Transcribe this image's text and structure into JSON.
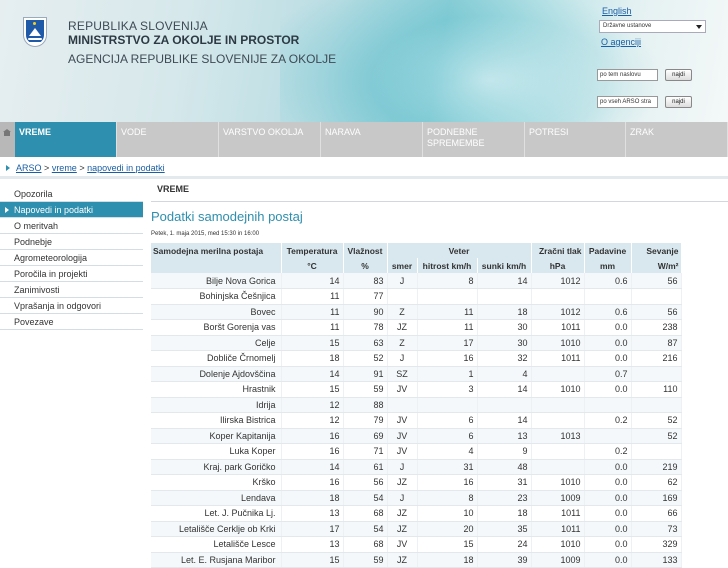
{
  "header": {
    "line1": "REPUBLIKA SLOVENIJA",
    "line2": "MINISTRSTVO ZA OKOLJE IN PROSTOR",
    "line3": "AGENCIJA REPUBLIKE SLOVENIJE ZA OKOLJE",
    "lang": "English",
    "select_value": "Državne ustanove",
    "o_agenciji": "O agenciji",
    "search1_value": "po tem naslovu",
    "search2_value": "po vseh ARSO stra",
    "search_button": "najdi"
  },
  "nav": [
    {
      "line1": "VREME",
      "line2": ""
    },
    {
      "line1": "VODE",
      "line2": ""
    },
    {
      "line1": "VARSTVO OKOLJA",
      "line2": ""
    },
    {
      "line1": "NARAVA",
      "line2": ""
    },
    {
      "line1": "PODNEBNE",
      "line2": "SPREMEMBE"
    },
    {
      "line1": "POTRESI",
      "line2": ""
    },
    {
      "line1": "ZRAK",
      "line2": ""
    }
  ],
  "breadcrumb": {
    "b1": "ARSO",
    "b2": "vreme",
    "b3": "napovedi in podatki",
    "sep": ">"
  },
  "sidebar": [
    "Opozorila",
    "Napovedi in podatki",
    "O meritvah",
    "Podnebje",
    "Agrometeorologija",
    "Poročila in projekti",
    "Zanimivosti",
    "Vprašanja in odgovori",
    "Povezave"
  ],
  "main": {
    "section": "VREME",
    "title": "Podatki samodejnih postaj",
    "date": "Petek, 1. maja 2015, med 15:30 in 16:00"
  },
  "table": {
    "h1": [
      "Samodejna merilna postaja",
      "Temperatura",
      "Vlažnost",
      "Veter",
      "Zračni tlak",
      "Padavine",
      "Sevanje"
    ],
    "h2": [
      "",
      "°C",
      "%",
      "smer",
      "hitrost km/h",
      "sunki km/h",
      "hPa",
      "mm",
      "W/m²"
    ],
    "rows": [
      [
        "Bilje Nova Gorica",
        "14",
        "83",
        "J",
        "8",
        "14",
        "1012",
        "0.6",
        "56"
      ],
      [
        "Bohinjska Češnjica",
        "11",
        "77",
        "",
        "",
        "",
        "",
        "",
        ""
      ],
      [
        "Bovec",
        "11",
        "90",
        "Z",
        "11",
        "18",
        "1012",
        "0.6",
        "56"
      ],
      [
        "Boršt Gorenja vas",
        "11",
        "78",
        "JZ",
        "11",
        "30",
        "1011",
        "0.0",
        "238"
      ],
      [
        "Celje",
        "15",
        "63",
        "Z",
        "17",
        "30",
        "1010",
        "0.0",
        "87"
      ],
      [
        "Dobliče Črnomelj",
        "18",
        "52",
        "J",
        "16",
        "32",
        "1011",
        "0.0",
        "216"
      ],
      [
        "Dolenje Ajdovščina",
        "14",
        "91",
        "SZ",
        "1",
        "4",
        "",
        "0.7",
        ""
      ],
      [
        "Hrastnik",
        "15",
        "59",
        "JV",
        "3",
        "14",
        "1010",
        "0.0",
        "110"
      ],
      [
        "Idrija",
        "12",
        "88",
        "",
        "",
        "",
        "",
        "",
        ""
      ],
      [
        "Ilirska Bistrica",
        "12",
        "79",
        "JV",
        "6",
        "14",
        "",
        "0.2",
        "52"
      ],
      [
        "Koper Kapitanija",
        "16",
        "69",
        "JV",
        "6",
        "13",
        "1013",
        "",
        "52"
      ],
      [
        "Luka Koper",
        "16",
        "71",
        "JV",
        "4",
        "9",
        "",
        "0.2",
        ""
      ],
      [
        "Kraj. park Goričko",
        "14",
        "61",
        "J",
        "31",
        "48",
        "",
        "0.0",
        "219"
      ],
      [
        "Krško",
        "16",
        "56",
        "JZ",
        "16",
        "31",
        "1010",
        "0.0",
        "62"
      ],
      [
        "Lendava",
        "18",
        "54",
        "J",
        "8",
        "23",
        "1009",
        "0.0",
        "169"
      ],
      [
        "Let. J. Pučnika Lj.",
        "13",
        "68",
        "JZ",
        "10",
        "18",
        "1011",
        "0.0",
        "66"
      ],
      [
        "Letališče Cerklje ob Krki",
        "17",
        "54",
        "JZ",
        "20",
        "35",
        "1011",
        "0.0",
        "73"
      ],
      [
        "Letališče Lesce",
        "13",
        "68",
        "JV",
        "15",
        "24",
        "1010",
        "0.0",
        "329"
      ],
      [
        "Let. E. Rusjana Maribor",
        "15",
        "59",
        "JZ",
        "18",
        "39",
        "1009",
        "0.0",
        "133"
      ]
    ]
  }
}
